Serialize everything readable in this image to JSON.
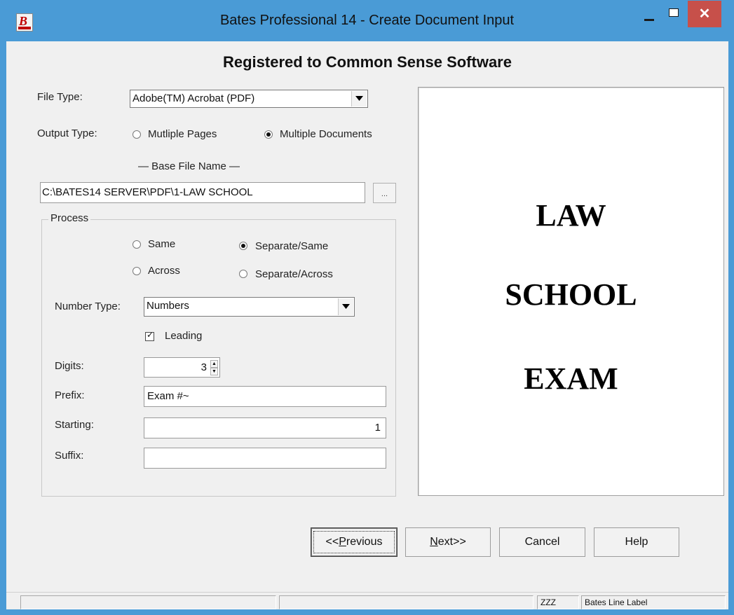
{
  "window": {
    "title": "Bates Professional 14 - Create Document Input",
    "close_glyph": "✕",
    "app_icon_letter": "B",
    "accent_color": "#4a9bd6",
    "close_color": "#c7504a"
  },
  "registration": "Registered to Common Sense Software",
  "file_type": {
    "label": "File Type:",
    "value": "Adobe(TM) Acrobat (PDF)"
  },
  "output_type": {
    "label": "Output Type:",
    "options": [
      {
        "label": "Mutliple Pages",
        "selected": false
      },
      {
        "label": "Multiple Documents",
        "selected": true
      }
    ]
  },
  "base_file": {
    "label": "— Base File Name —",
    "value": "C:\\BATES14 SERVER\\PDF\\1-LAW SCHOOL",
    "browse_label": "..."
  },
  "process": {
    "label": "Process",
    "options": [
      {
        "label": "Same",
        "selected": false
      },
      {
        "label": "Separate/Same",
        "selected": true
      },
      {
        "label": "Across",
        "selected": false
      },
      {
        "label": "Separate/Across",
        "selected": false
      }
    ],
    "number_type": {
      "label": "Number Type:",
      "value": "Numbers"
    },
    "leading": {
      "label": "Leading",
      "checked": true,
      "check_glyph": "✓"
    },
    "digits": {
      "label": "Digits:",
      "value": "3",
      "up_glyph": "▲",
      "down_glyph": "▼"
    },
    "prefix": {
      "label": "Prefix:",
      "value": "Exam #~"
    },
    "starting": {
      "label": "Starting:",
      "value": "1"
    },
    "suffix": {
      "label": "Suffix:",
      "value": ""
    }
  },
  "preview": {
    "lines": [
      "LAW",
      "SCHOOL",
      "EXAM"
    ]
  },
  "buttons": {
    "previous_prefix": "<<",
    "previous_mnemonic": "P",
    "previous_rest": "revious",
    "next_mnemonic": "N",
    "next_rest": "ext>>",
    "cancel": "Cancel",
    "help": "Help"
  },
  "status": {
    "pane1": "",
    "pane2": "",
    "pane3": "ZZZ",
    "pane4": "Bates Line Label"
  }
}
